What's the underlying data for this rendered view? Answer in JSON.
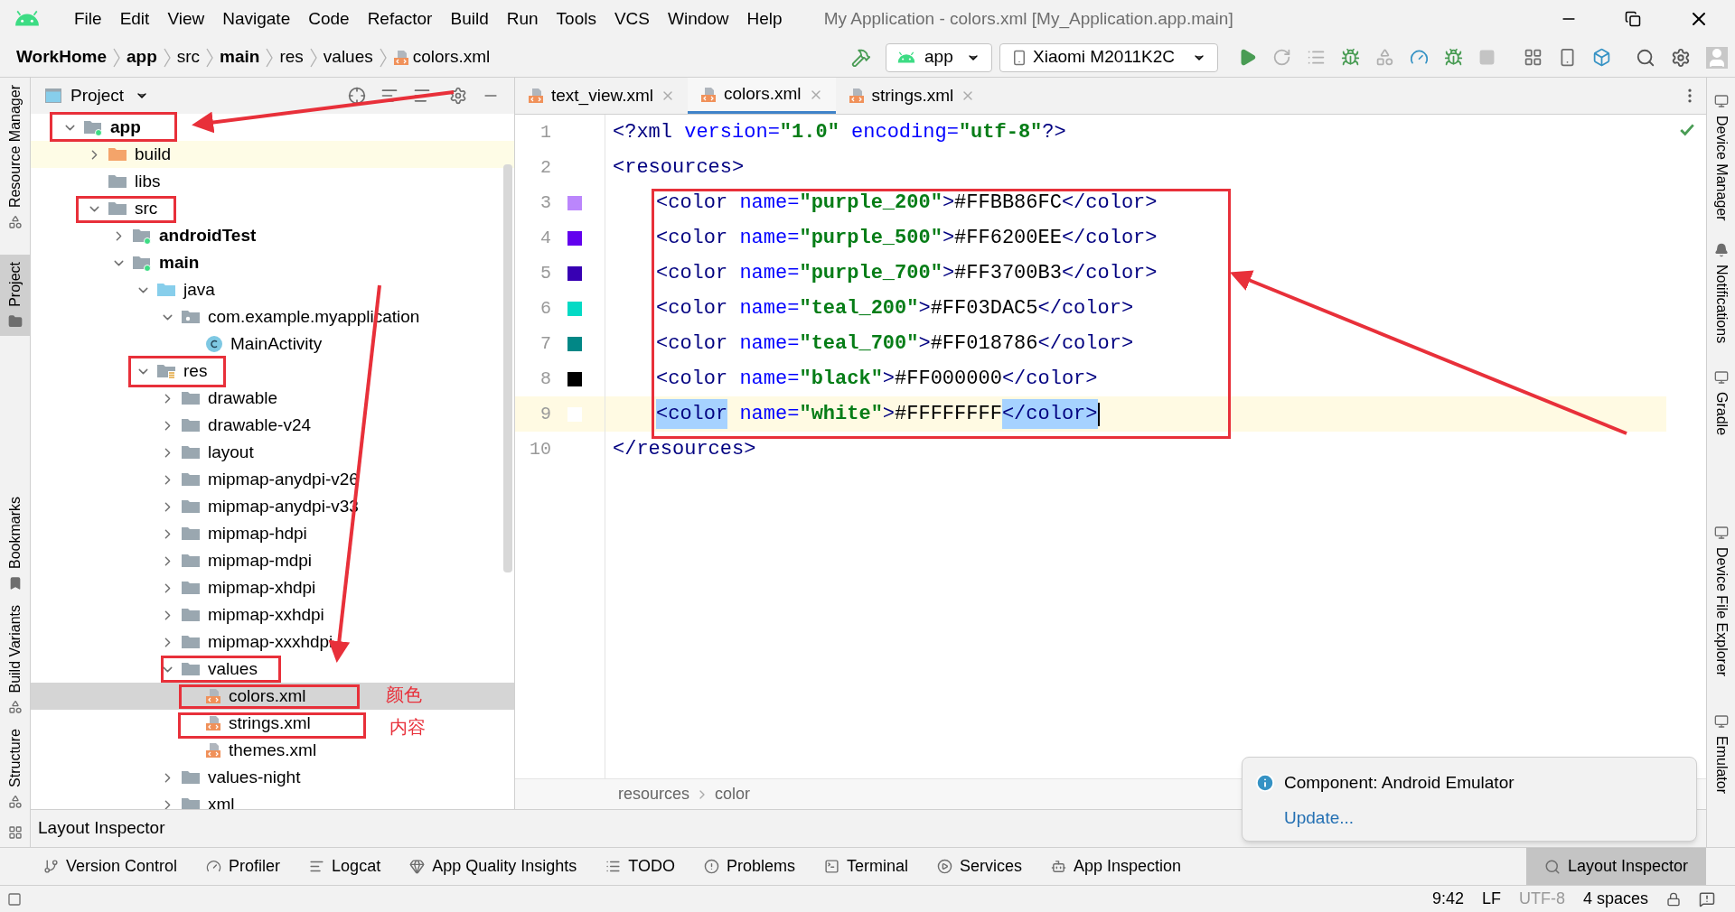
{
  "menu": [
    "File",
    "Edit",
    "View",
    "Navigate",
    "Code",
    "Refactor",
    "Build",
    "Run",
    "Tools",
    "VCS",
    "Window",
    "Help"
  ],
  "window": {
    "title": "My Application - colors.xml [My_Application.app.main]"
  },
  "breadcrumbs": [
    {
      "label": "WorkHome",
      "bold": true
    },
    {
      "label": "app",
      "bold": true
    },
    {
      "label": "src",
      "bold": false
    },
    {
      "label": "main",
      "bold": true
    },
    {
      "label": "res",
      "bold": false
    },
    {
      "label": "values",
      "bold": false
    },
    {
      "label": "colors.xml",
      "bold": false,
      "kind": "xml"
    }
  ],
  "run_config": "app",
  "device": "Xiaomi M2011K2C",
  "left_strip": [
    {
      "label": "Resource Manager",
      "selected": false
    },
    {
      "label": "Project",
      "selected": true
    },
    {
      "label": "Bookmarks",
      "selected": false
    },
    {
      "label": "Build Variants",
      "selected": false
    },
    {
      "label": "Structure",
      "selected": false
    }
  ],
  "right_strip": [
    "Device Manager",
    "Notifications",
    "Gradle",
    "Device File Explorer",
    "Emulator"
  ],
  "project_panel": {
    "title": "Project",
    "tree": [
      {
        "label": "app",
        "kind": "module",
        "bold": true,
        "expanded": true,
        "selected": false,
        "highlighted": false,
        "children": [
          {
            "label": "build",
            "kind": "folder-orange",
            "bold": false,
            "expanded": false,
            "selected": false,
            "highlighted": true
          },
          {
            "label": "libs",
            "kind": "folder",
            "bold": false,
            "selected": false,
            "highlighted": false
          },
          {
            "label": "src",
            "kind": "folder",
            "bold": false,
            "expanded": true,
            "selected": false,
            "highlighted": false,
            "children": [
              {
                "label": "androidTest",
                "kind": "module",
                "bold": true,
                "expanded": false,
                "selected": false,
                "highlighted": false
              },
              {
                "label": "main",
                "kind": "module",
                "bold": true,
                "expanded": true,
                "selected": false,
                "highlighted": false,
                "children": [
                  {
                    "label": "java",
                    "kind": "folder-blue",
                    "bold": false,
                    "expanded": true,
                    "selected": false,
                    "highlighted": false,
                    "children": [
                      {
                        "label": "com.example.myapplication",
                        "kind": "package",
                        "bold": false,
                        "expanded": true,
                        "selected": false,
                        "highlighted": false,
                        "children": [
                          {
                            "label": "MainActivity",
                            "kind": "class",
                            "bold": false,
                            "selected": false,
                            "highlighted": false
                          }
                        ]
                      }
                    ]
                  },
                  {
                    "label": "res",
                    "kind": "res",
                    "bold": false,
                    "expanded": true,
                    "selected": false,
                    "highlighted": false,
                    "children": [
                      {
                        "label": "drawable",
                        "kind": "folder",
                        "bold": false,
                        "expanded": false,
                        "selected": false,
                        "highlighted": false
                      },
                      {
                        "label": "drawable-v24",
                        "kind": "folder",
                        "bold": false,
                        "expanded": false,
                        "selected": false,
                        "highlighted": false
                      },
                      {
                        "label": "layout",
                        "kind": "folder",
                        "bold": false,
                        "expanded": false,
                        "selected": false,
                        "highlighted": false
                      },
                      {
                        "label": "mipmap-anydpi-v26",
                        "kind": "folder",
                        "bold": false,
                        "expanded": false,
                        "selected": false,
                        "highlighted": false
                      },
                      {
                        "label": "mipmap-anydpi-v33",
                        "kind": "folder",
                        "bold": false,
                        "expanded": false,
                        "selected": false,
                        "highlighted": false
                      },
                      {
                        "label": "mipmap-hdpi",
                        "kind": "folder",
                        "bold": false,
                        "expanded": false,
                        "selected": false,
                        "highlighted": false
                      },
                      {
                        "label": "mipmap-mdpi",
                        "kind": "folder",
                        "bold": false,
                        "expanded": false,
                        "selected": false,
                        "highlighted": false
                      },
                      {
                        "label": "mipmap-xhdpi",
                        "kind": "folder",
                        "bold": false,
                        "expanded": false,
                        "selected": false,
                        "highlighted": false
                      },
                      {
                        "label": "mipmap-xxhdpi",
                        "kind": "folder",
                        "bold": false,
                        "expanded": false,
                        "selected": false,
                        "highlighted": false
                      },
                      {
                        "label": "mipmap-xxxhdpi",
                        "kind": "folder",
                        "bold": false,
                        "expanded": false,
                        "selected": false,
                        "highlighted": false
                      },
                      {
                        "label": "values",
                        "kind": "folder",
                        "bold": false,
                        "expanded": true,
                        "selected": false,
                        "highlighted": false,
                        "children": [
                          {
                            "label": "colors.xml",
                            "kind": "xml",
                            "bold": false,
                            "selected": true,
                            "highlighted": false
                          },
                          {
                            "label": "strings.xml",
                            "kind": "xml",
                            "bold": false,
                            "selected": false,
                            "highlighted": false
                          },
                          {
                            "label": "themes.xml",
                            "kind": "xml",
                            "bold": false,
                            "selected": false,
                            "highlighted": false
                          }
                        ]
                      },
                      {
                        "label": "values-night",
                        "kind": "folder",
                        "bold": false,
                        "expanded": false,
                        "selected": false,
                        "highlighted": false
                      },
                      {
                        "label": "xml",
                        "kind": "folder",
                        "bold": false,
                        "expanded": false,
                        "selected": false,
                        "highlighted": false
                      }
                    ]
                  }
                ]
              }
            ]
          }
        ]
      }
    ]
  },
  "annotations": [
    "颜色",
    "内容"
  ],
  "tabs": [
    {
      "label": "text_view.xml",
      "selected": false
    },
    {
      "label": "colors.xml",
      "selected": true
    },
    {
      "label": "strings.xml",
      "selected": false
    }
  ],
  "code": [
    {
      "number": "1",
      "current": false,
      "segments": [
        {
          "kind": "tag",
          "text": "<?xml ",
          "selected": false
        },
        {
          "kind": "attr",
          "text": "version=",
          "selected": false
        },
        {
          "kind": "value",
          "text": "\"1.0\" ",
          "selected": false
        },
        {
          "kind": "attr",
          "text": "encoding=",
          "selected": false
        },
        {
          "kind": "value",
          "text": "\"utf-8\"",
          "selected": false
        },
        {
          "kind": "tag",
          "text": "?>",
          "selected": false
        }
      ]
    },
    {
      "number": "2",
      "current": false,
      "segments": [
        {
          "kind": "tag",
          "text": "<resources>",
          "selected": false
        }
      ]
    },
    {
      "number": "3",
      "current": false,
      "color": "#bb86fc",
      "segments": [
        {
          "kind": "tag",
          "text": "<color",
          "selected": false
        },
        {
          "kind": "attr",
          "text": " name=",
          "selected": false
        },
        {
          "kind": "value",
          "text": "\"purple_200\"",
          "selected": false
        },
        {
          "kind": "tag",
          "text": ">",
          "selected": false
        },
        {
          "kind": "text",
          "text": "#FFBB86FC",
          "selected": false
        },
        {
          "kind": "tag",
          "text": "</color>",
          "selected": false
        }
      ]
    },
    {
      "number": "4",
      "current": false,
      "color": "#6200ee",
      "segments": [
        {
          "kind": "tag",
          "text": "<color",
          "selected": false
        },
        {
          "kind": "attr",
          "text": " name=",
          "selected": false
        },
        {
          "kind": "value",
          "text": "\"purple_500\"",
          "selected": false
        },
        {
          "kind": "tag",
          "text": ">",
          "selected": false
        },
        {
          "kind": "text",
          "text": "#FF6200EE",
          "selected": false
        },
        {
          "kind": "tag",
          "text": "</color>",
          "selected": false
        }
      ]
    },
    {
      "number": "5",
      "current": false,
      "color": "#3700b3",
      "segments": [
        {
          "kind": "tag",
          "text": "<color",
          "selected": false
        },
        {
          "kind": "attr",
          "text": " name=",
          "selected": false
        },
        {
          "kind": "value",
          "text": "\"purple_700\"",
          "selected": false
        },
        {
          "kind": "tag",
          "text": ">",
          "selected": false
        },
        {
          "kind": "text",
          "text": "#FF3700B3",
          "selected": false
        },
        {
          "kind": "tag",
          "text": "</color>",
          "selected": false
        }
      ]
    },
    {
      "number": "6",
      "current": false,
      "color": "#03dac5",
      "segments": [
        {
          "kind": "tag",
          "text": "<color",
          "selected": false
        },
        {
          "kind": "attr",
          "text": " name=",
          "selected": false
        },
        {
          "kind": "value",
          "text": "\"teal_200\"",
          "selected": false
        },
        {
          "kind": "tag",
          "text": ">",
          "selected": false
        },
        {
          "kind": "text",
          "text": "#FF03DAC5",
          "selected": false
        },
        {
          "kind": "tag",
          "text": "</color>",
          "selected": false
        }
      ]
    },
    {
      "number": "7",
      "current": false,
      "color": "#018786",
      "segments": [
        {
          "kind": "tag",
          "text": "<color",
          "selected": false
        },
        {
          "kind": "attr",
          "text": " name=",
          "selected": false
        },
        {
          "kind": "value",
          "text": "\"teal_700\"",
          "selected": false
        },
        {
          "kind": "tag",
          "text": ">",
          "selected": false
        },
        {
          "kind": "text",
          "text": "#FF018786",
          "selected": false
        },
        {
          "kind": "tag",
          "text": "</color>",
          "selected": false
        }
      ]
    },
    {
      "number": "8",
      "current": false,
      "color": "#000000",
      "segments": [
        {
          "kind": "tag",
          "text": "<color",
          "selected": false
        },
        {
          "kind": "attr",
          "text": " name=",
          "selected": false
        },
        {
          "kind": "value",
          "text": "\"black\"",
          "selected": false
        },
        {
          "kind": "tag",
          "text": ">",
          "selected": false
        },
        {
          "kind": "text",
          "text": "#FF000000",
          "selected": false
        },
        {
          "kind": "tag",
          "text": "</color>",
          "selected": false
        }
      ]
    },
    {
      "number": "9",
      "current": true,
      "color": "#ffffff",
      "segments": [
        {
          "kind": "tag",
          "text": "<color",
          "selected": true
        },
        {
          "kind": "attr",
          "text": " name=",
          "selected": false
        },
        {
          "kind": "value",
          "text": "\"white\"",
          "selected": false
        },
        {
          "kind": "tag",
          "text": ">",
          "selected": false
        },
        {
          "kind": "text",
          "text": "#FFFFFFFF",
          "selected": false
        },
        {
          "kind": "tag",
          "text": "</color>",
          "selected": true
        }
      ]
    },
    {
      "number": "10",
      "current": false,
      "segments": [
        {
          "kind": "tag",
          "text": "</resources>",
          "selected": false
        }
      ]
    }
  ],
  "editor_breadcrumbs": [
    "resources",
    "color"
  ],
  "notification": {
    "title": "Component: Android Emulator",
    "link": "Update..."
  },
  "layout_inspector_panel": {
    "title": "Layout Inspector"
  },
  "bottom_tools": [
    "Version Control",
    "Profiler",
    "Logcat",
    "App Quality Insights",
    "TODO",
    "Problems",
    "Terminal",
    "Services",
    "App Inspection"
  ],
  "layout_inspector_tool": {
    "label": "Layout Inspector",
    "selected": true
  },
  "status_bar": [
    {
      "label": "9:42",
      "disabled": false
    },
    {
      "label": "LF",
      "disabled": false
    },
    {
      "label": "UTF-8",
      "disabled": true
    },
    {
      "label": "4 spaces",
      "disabled": false
    }
  ]
}
